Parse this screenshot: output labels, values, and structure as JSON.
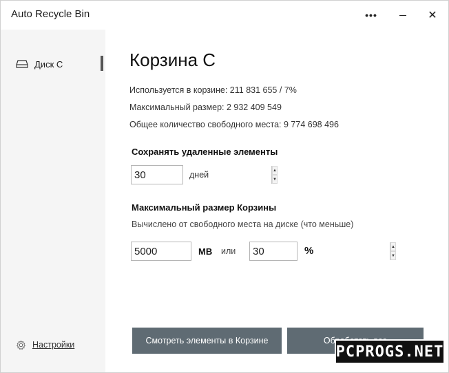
{
  "window": {
    "title": "Auto Recycle Bin",
    "more_label": "•••",
    "close_label": "✕"
  },
  "sidebar": {
    "items": [
      {
        "label": "Диск C",
        "icon": "drive-icon",
        "selected": true
      }
    ],
    "settings_label": "Настройки"
  },
  "main": {
    "title": "Корзина C",
    "info": [
      "Используется в корзине: 211 831 655 / 7%",
      "Максимальный размер: 2 932 409 549",
      "Общее количество свободного места: 9 774 698 496"
    ],
    "keep": {
      "title": "Сохранять удаленные элементы",
      "value": "30",
      "unit": "дней"
    },
    "max_size": {
      "title": "Максимальный размер Корзины",
      "subtitle": "Вычислено от свободного места на диске (что меньше)",
      "mb_value": "5000",
      "mb_unit": "MB",
      "or_label": "или",
      "percent_value": "30",
      "percent_unit": "%"
    },
    "buttons": {
      "view": "Смотреть элементы в Корзине",
      "process": "Обработать все"
    }
  },
  "watermark": "PCPROGS.NET",
  "colors": {
    "sidebar_bg": "#f5f5f5",
    "button_bg": "#5f6b73",
    "indicator": "#555555"
  }
}
